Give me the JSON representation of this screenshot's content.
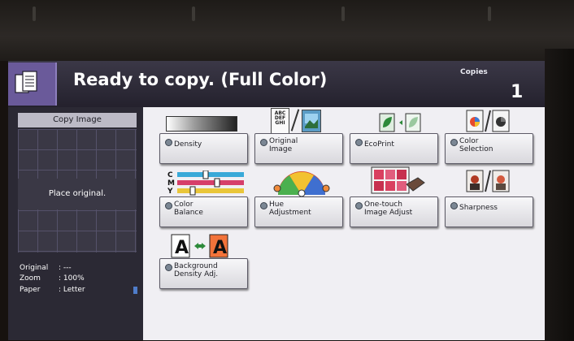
{
  "header": {
    "title": "Ready to copy. (Full Color)",
    "copies_label": "Copies",
    "copies_value": "1",
    "mode_icon": "copy-mode-icon"
  },
  "left_panel": {
    "preview_title": "Copy Image",
    "preview_text": "Place original.",
    "info": [
      {
        "key": "Original",
        "value": ": ---"
      },
      {
        "key": "Zoom",
        "value": ": 100%"
      },
      {
        "key": "Paper",
        "value": ": Letter"
      }
    ]
  },
  "functions": {
    "row1": [
      {
        "label": "Density",
        "icon": "density-gradient-icon"
      },
      {
        "label": "Original\nImage",
        "icon": "original-image-icon"
      },
      {
        "label": "EcoPrint",
        "icon": "ecoprint-icon"
      },
      {
        "label": "Color\nSelection",
        "icon": "color-selection-icon"
      }
    ],
    "row2": [
      {
        "label": "Color\nBalance",
        "icon": "color-balance-icon"
      },
      {
        "label": "Hue\nAdjustment",
        "icon": "hue-adjustment-icon"
      },
      {
        "label": "One-touch\nImage Adjust",
        "icon": "one-touch-icon"
      },
      {
        "label": "Sharpness",
        "icon": "sharpness-icon"
      }
    ],
    "row3": [
      {
        "label": "Background\nDensity Adj.",
        "icon": "background-density-icon"
      }
    ],
    "icon_text": {
      "abc": "ABC",
      "def": "DEF",
      "ghi": "GHI",
      "c": "C",
      "m": "M",
      "y": "Y",
      "a": "A"
    }
  },
  "colors": {
    "header_bg": "#2a2733",
    "panel_bg": "#2b2934",
    "screen_bg": "#f0eff3",
    "mode_icon_bg": "#6a5a9a"
  }
}
